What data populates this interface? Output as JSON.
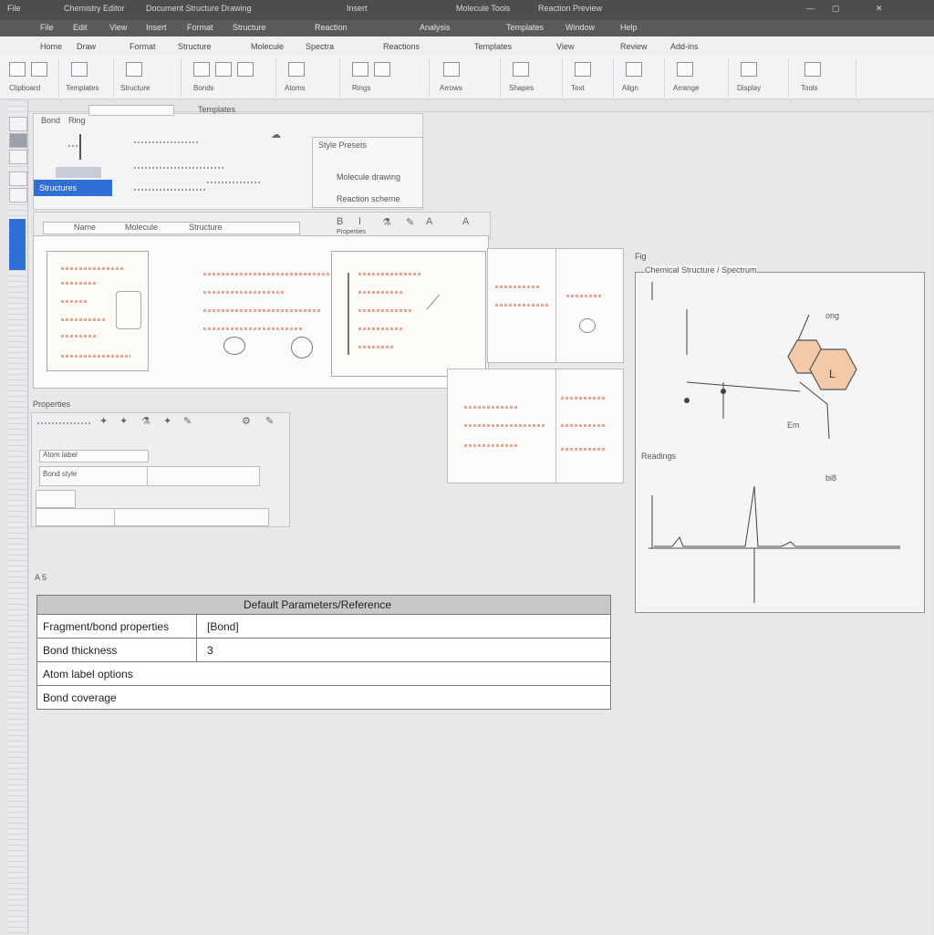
{
  "window": {
    "title_left": "File",
    "title_items": [
      "Chemistry Editor",
      "Document Structure Drawing",
      "Insert",
      "Molecule Tools",
      "Reaction Preview"
    ],
    "controls": [
      "—",
      "▢",
      "✕"
    ]
  },
  "menubar": {
    "items": [
      "File",
      "Edit",
      "View",
      "Insert",
      "Format",
      "Structure",
      "Reaction",
      "Analysis",
      "Templates",
      "Window",
      "Help"
    ]
  },
  "tabbar": {
    "items": [
      "Home",
      "Draw",
      "Format",
      "Structure",
      "Molecule",
      "Spectra",
      "Reactions",
      "Templates",
      "View",
      "Review",
      "Add-ins"
    ]
  },
  "ribbon": {
    "groups": [
      "Clipboard",
      "Templates",
      "Structure",
      "Bonds",
      "Atoms",
      "Rings",
      "Arrows",
      "Shapes",
      "Text",
      "Align",
      "Arrange",
      "Display",
      "Tools"
    ]
  },
  "left_panel": {
    "tab1": "Bond",
    "tab2": "Ring",
    "tab3": "Templates",
    "selected_item": "Structures"
  },
  "style_box": {
    "title": "Style Presets",
    "row1": "Molecule drawing",
    "row2": "Reaction scheme"
  },
  "toolbar_row": {
    "field1": "Name",
    "field2": "Molecule",
    "field3": "Structure",
    "field4": "Properties"
  },
  "properties_section": {
    "label": "Properties",
    "item1": "Atom label",
    "item2": "Bond style"
  },
  "figure_box": {
    "label": "Fig",
    "caption": "Chemical Structure / Spectrum",
    "ring_label": "L",
    "annotation_top": "ong",
    "annotation_bottom": "Em",
    "spectrum_label": "Readings",
    "spectrum_value": "bi8"
  },
  "section_label": "A 5",
  "table": {
    "header": "Default Parameters/Reference",
    "rows": [
      {
        "label": "Fragment/bond properties",
        "value": "[Bond]"
      },
      {
        "label": "Bond thickness",
        "value": "3"
      },
      {
        "label": "Atom label options",
        "value": ""
      },
      {
        "label": "Bond coverage",
        "value": ""
      }
    ]
  },
  "colors": {
    "accent": "#2f6fd6",
    "ring_fill": "#f3c9a8",
    "titlebar": "#4d4d4f"
  }
}
